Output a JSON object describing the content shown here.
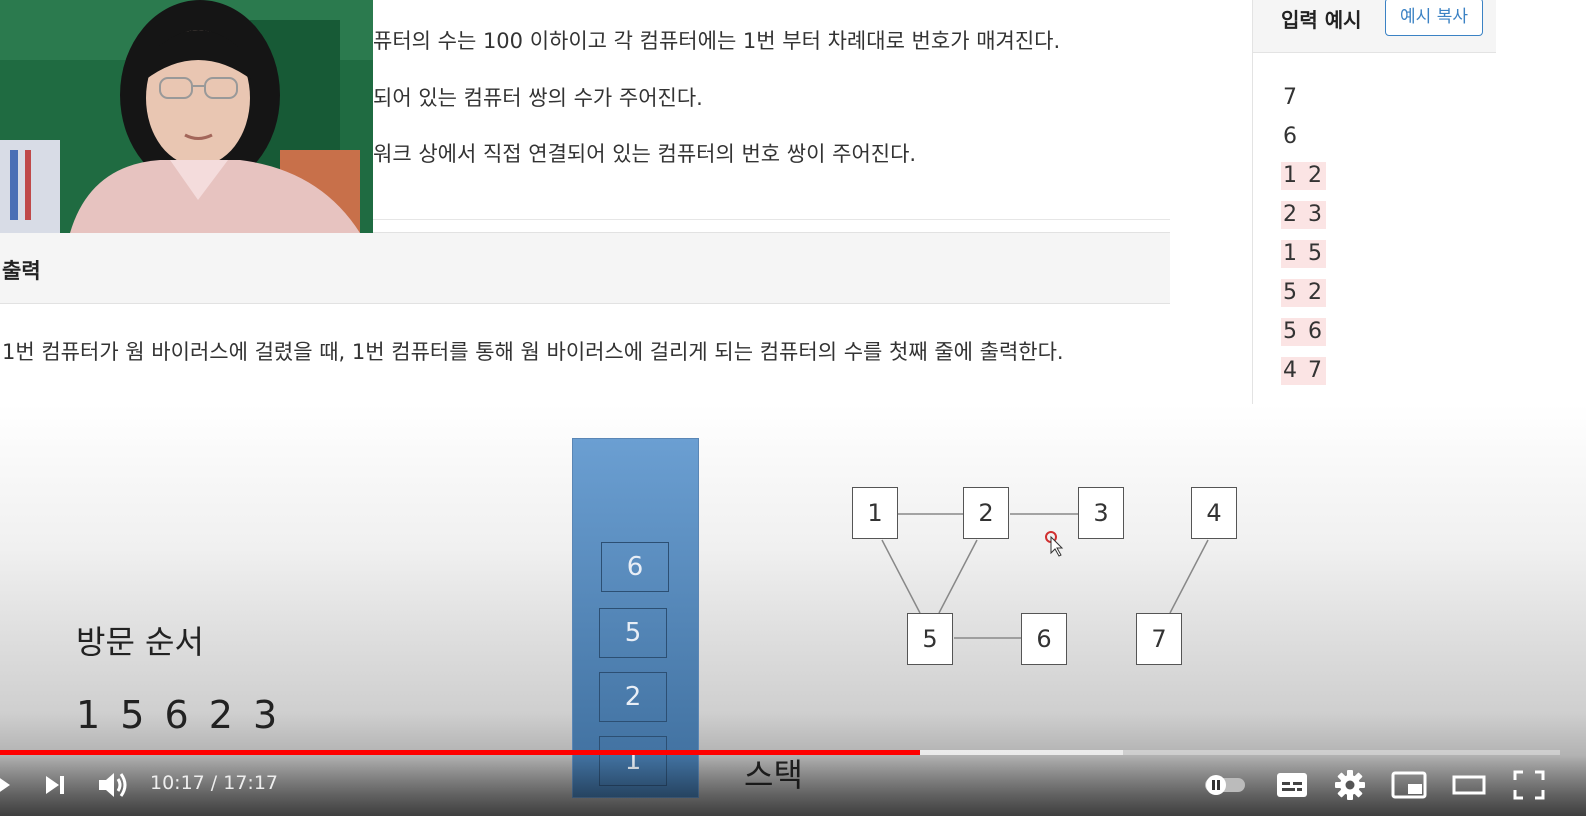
{
  "problem": {
    "input_lines": [
      "퓨터의 수는 100 이하이고 각 컴퓨터에는 1번 부터 차례대로 번호가 매겨진다.",
      "되어 있는 컴퓨터 쌍의 수가 주어진다.",
      "워크 상에서 직접 연결되어 있는 컴퓨터의 번호 쌍이 주어진다."
    ],
    "output_title": "출력",
    "output_text": "1번 컴퓨터가 웜 바이러스에 걸렸을 때, 1번 컴퓨터를 통해 웜 바이러스에 걸리게 되는 컴퓨터의 수를 첫째 줄에 출력한다."
  },
  "sample": {
    "title": "입력 예시",
    "copy_button": "예시 복사",
    "lines": [
      "7",
      "6",
      "1 2",
      "2 3",
      "1 5",
      "5 2",
      "5 6",
      "4 7"
    ]
  },
  "slide": {
    "visit_label": "방문 순서",
    "visit_sequence": "1 5 6 2 3",
    "stack_items": [
      "6",
      "5",
      "2",
      "1"
    ],
    "stack_label": "스택",
    "nodes": [
      "1",
      "2",
      "3",
      "4",
      "5",
      "6",
      "7"
    ]
  },
  "player": {
    "current_time": "10:17",
    "separator": " / ",
    "duration": "17:17",
    "progress": 0.59,
    "buffered": 0.72
  },
  "colors": {
    "progress": "#ff0000",
    "stack": "#5b8ec4",
    "copy_button": "#3b82c4",
    "sample_highlight": "#fbe4e4"
  }
}
